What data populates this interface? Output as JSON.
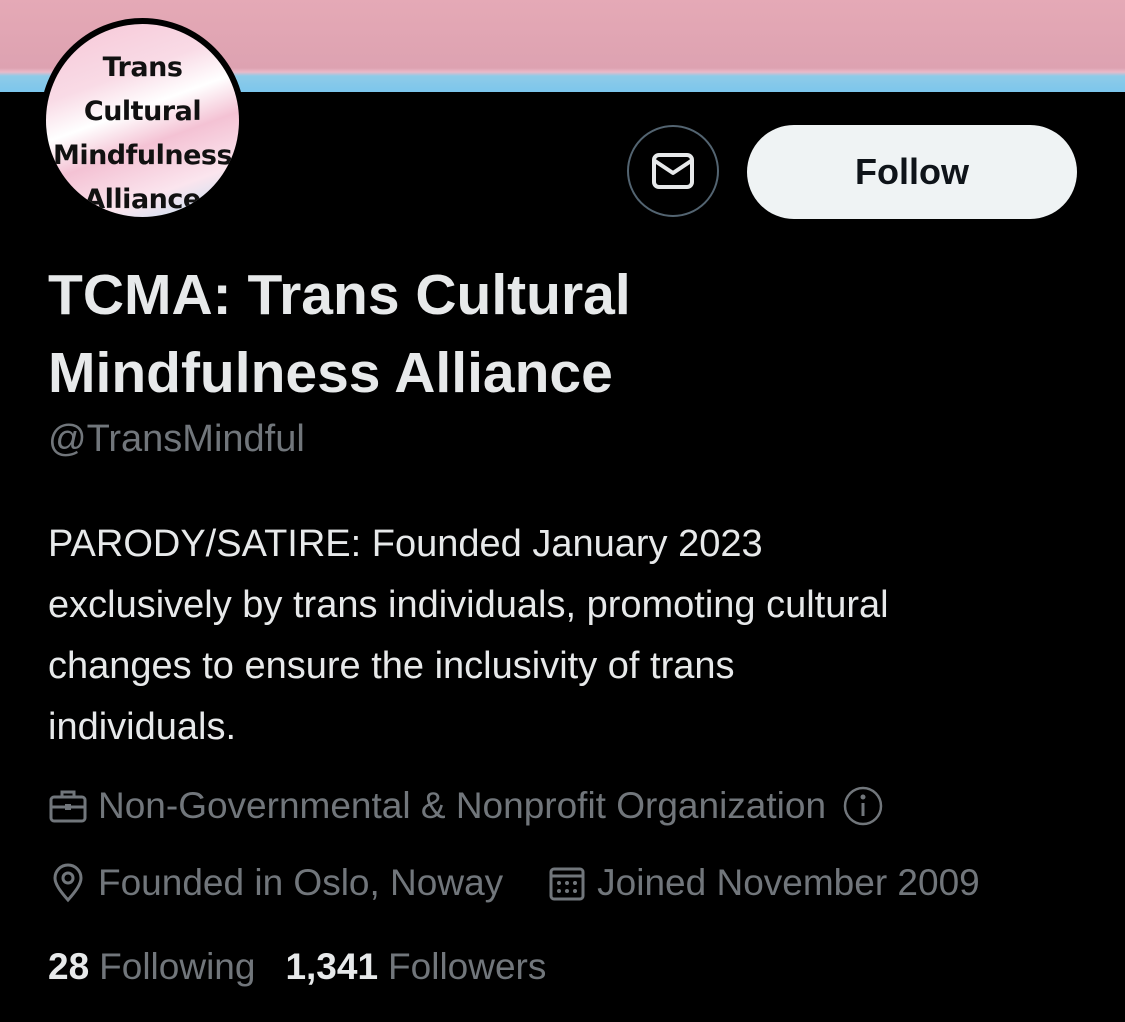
{
  "profile": {
    "avatar_lines": [
      "Trans",
      "Cultural",
      "Mindfulness",
      "Alliance"
    ],
    "display_name_line1": "TCMA: Trans Cultural",
    "display_name_line2": "Mindfulness Alliance",
    "handle": "@TransMindful",
    "bio_lines": [
      "PARODY/SATIRE: Founded January 2023",
      "exclusively by trans individuals, promoting cultural",
      "changes to ensure the inclusivity of trans",
      "individuals."
    ]
  },
  "actions": {
    "message_icon": "envelope-icon",
    "follow_label": "Follow"
  },
  "meta": {
    "category": "Non-Governmental & Nonprofit Organization",
    "location": "Founded in Oslo, Noway",
    "joined": "Joined November 2009"
  },
  "stats": {
    "following_count": "28",
    "following_label": "Following",
    "followers_count": "1,341",
    "followers_label": "Followers"
  },
  "colors": {
    "banner_pink": "#dda2b1",
    "banner_blue": "#7cc6ec",
    "background": "#000000",
    "muted_text": "#71767b",
    "follow_bg": "#eff3f4"
  }
}
